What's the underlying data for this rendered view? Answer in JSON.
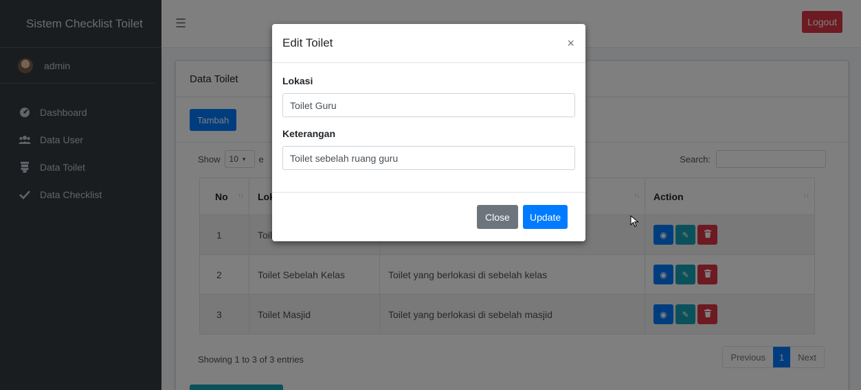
{
  "sidebar": {
    "brand": "Sistem Checklist Toilet",
    "user": "admin",
    "items": [
      {
        "label": "Dashboard",
        "icon": "dashboard-icon"
      },
      {
        "label": "Data User",
        "icon": "users-icon"
      },
      {
        "label": "Data Toilet",
        "icon": "toilet-icon"
      },
      {
        "label": "Data Checklist",
        "icon": "check-icon"
      }
    ]
  },
  "navbar": {
    "logout_label": "Logout"
  },
  "card": {
    "title": "Data Toilet",
    "add_label": "Tambah",
    "show_prefix": "Show",
    "page_length": "10",
    "show_suffix": "e",
    "search_label": "Search:",
    "columns": [
      "No",
      "Lok",
      "",
      "Action"
    ],
    "rows": [
      {
        "no": "1",
        "lokasi": "Toil",
        "keterangan": ""
      },
      {
        "no": "2",
        "lokasi": "Toilet Sebelah Kelas",
        "keterangan": "Toilet yang berlokasi di sebelah kelas"
      },
      {
        "no": "3",
        "lokasi": "Toilet Masjid",
        "keterangan": "Toilet yang berlokasi di sebelah masjid"
      }
    ],
    "info": "Showing 1 to 3 of 3 entries",
    "pager": {
      "prev": "Previous",
      "current": "1",
      "next": "Next"
    }
  },
  "modal": {
    "title": "Edit Toilet",
    "close_glyph": "×",
    "lokasi_label": "Lokasi",
    "lokasi_value": "Toilet Guru",
    "keterangan_label": "Keterangan",
    "keterangan_value": "Toilet sebelah ruang guru",
    "close_label": "Close",
    "update_label": "Update"
  },
  "colors": {
    "sidebar": "#343a40",
    "primary": "#007bff",
    "info": "#17a2b8",
    "danger": "#dc3545",
    "secondary": "#6c757d"
  }
}
